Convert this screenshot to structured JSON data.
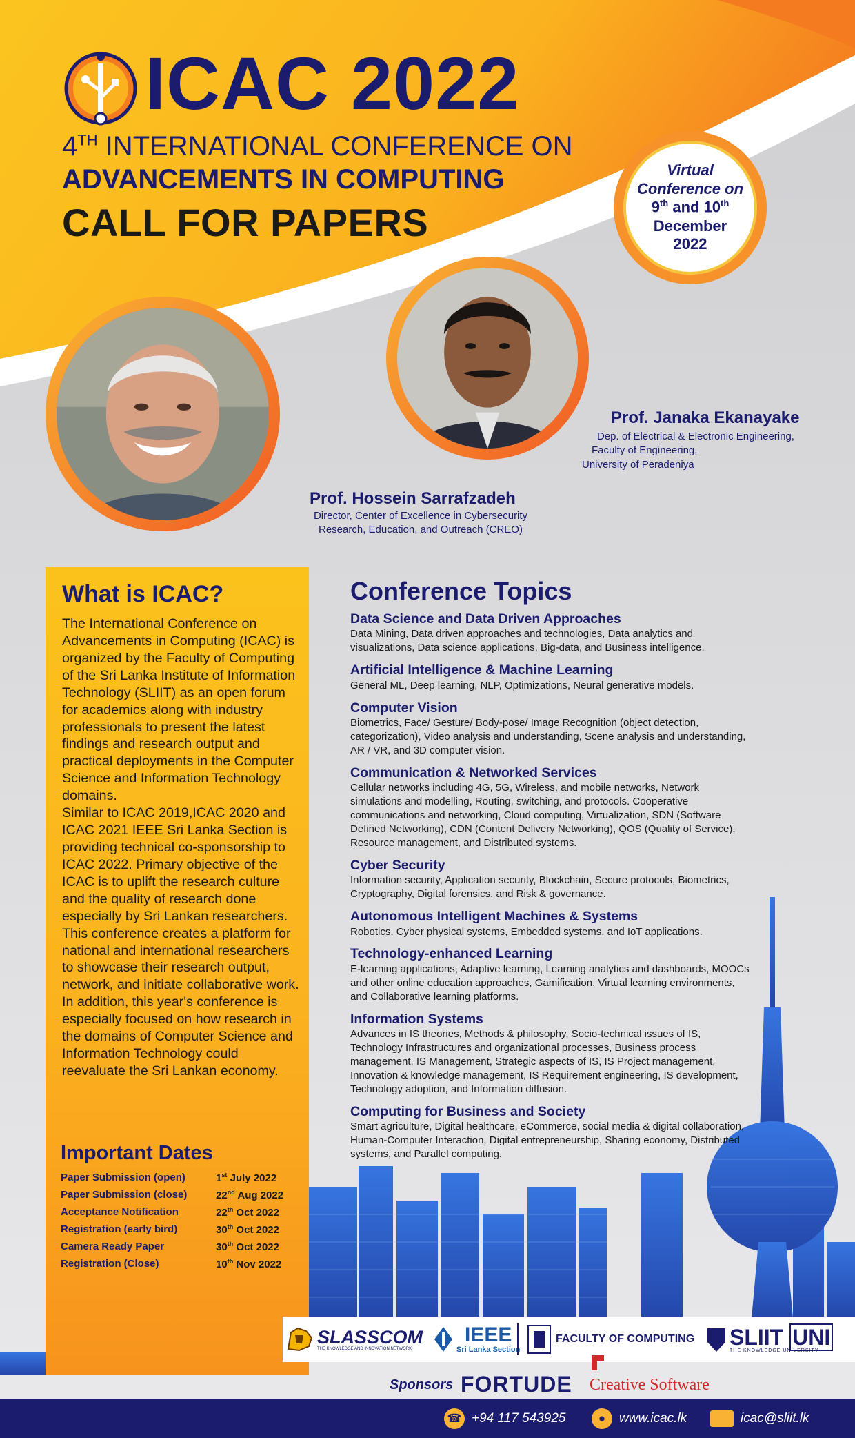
{
  "header": {
    "brand": "ICAC 2022",
    "conference_line1_prefix": "4",
    "conference_line1_sup": "TH",
    "conference_line1_rest": " INTERNATIONAL CONFERENCE ON",
    "conference_line2": "ADVANCEMENTS IN COMPUTING",
    "call_for_papers": "CALL FOR PAPERS"
  },
  "badge": {
    "line1": "Virtual",
    "line2": "Conference on",
    "day1": "9",
    "day1_sup": "th",
    "and": " and 10",
    "day2_sup": "th",
    "month": "December",
    "year": "2022"
  },
  "speakers": [
    {
      "name": "Prof. Hossein Sarrafzadeh",
      "role_line1": "Director, Center of Excellence in Cybersecurity",
      "role_line2": "Research, Education, and Outreach (CREO)"
    },
    {
      "name": "Prof. Janaka Ekanayake",
      "role_line1": "Dep. of Electrical & Electronic Engineering,",
      "role_line2": "Faculty of Engineering,",
      "role_line3": "University of Peradeniya"
    }
  ],
  "what": {
    "title": "What is ICAC?",
    "p1": "The International Conference on Advancements in Computing (ICAC) is organized by the Faculty of Computing of the Sri Lanka Institute of Information Technology (SLIIT) as an open forum for academics along with industry professionals to present the latest findings and research output and practical deployments in the Computer Science and Information Technology domains.",
    "p2": "Similar to ICAC 2019,ICAC 2020 and ICAC 2021 IEEE Sri Lanka Section is providing technical co-sponsorship to ICAC 2022. Primary objective of the ICAC is to uplift the research culture and the quality of research done especially by Sri Lankan researchers.",
    "p3": "This conference creates a platform for national and international researchers to showcase their research output, network, and initiate collaborative work. In addition, this year's conference is especially focused on how research in the domains of Computer Science and Information Technology could reevaluate the Sri Lankan economy."
  },
  "dates": {
    "title": "Important Dates",
    "rows": [
      {
        "label": "Paper Submission (open)",
        "day": "1",
        "sup": "st",
        "rest": " July 2022"
      },
      {
        "label": "Paper Submission (close)",
        "day": "22",
        "sup": "nd",
        "rest": " Aug 2022"
      },
      {
        "label": "Acceptance Notification",
        "day": "22",
        "sup": "th",
        "rest": " Oct 2022"
      },
      {
        "label": "Registration (early bird)",
        "day": "30",
        "sup": "th",
        "rest": " Oct 2022"
      },
      {
        "label": "Camera Ready Paper",
        "day": "30",
        "sup": "th",
        "rest": " Oct 2022"
      },
      {
        "label": "Registration (Close)",
        "day": "10",
        "sup": "th",
        "rest": " Nov 2022"
      }
    ]
  },
  "topics": {
    "title": "Conference Topics",
    "items": [
      {
        "h": "Data Science and Data Driven Approaches",
        "b": "Data Mining, Data driven approaches and technologies, Data analytics and visualizations, Data science applications, Big-data, and Business intelligence."
      },
      {
        "h": "Artificial Intelligence & Machine Learning",
        "b": "General ML, Deep learning, NLP, Optimizations, Neural generative models."
      },
      {
        "h": "Computer Vision",
        "b": "Biometrics, Face/ Gesture/ Body-pose/ Image Recognition (object detection, categorization), Video analysis and understanding, Scene analysis and understanding, AR / VR, and 3D computer vision."
      },
      {
        "h": "Communication & Networked Services",
        "b": "Cellular networks including 4G, 5G, Wireless, and mobile networks, Network simulations and modelling, Routing, switching, and protocols. Cooperative communications and networking, Cloud computing, Virtualization, SDN (Software Defined Networking), CDN (Content Delivery Networking), QOS (Quality of Service), Resource management, and Distributed systems."
      },
      {
        "h": "Cyber Security",
        "b": "Information security, Application security, Blockchain, Secure protocols, Biometrics, Cryptography, Digital forensics, and Risk & governance."
      },
      {
        "h": "Autonomous Intelligent Machines & Systems",
        "b": "Robotics, Cyber physical systems, Embedded systems, and IoT applications."
      },
      {
        "h": "Technology-enhanced Learning",
        "b": "E-learning applications, Adaptive learning, Learning analytics and dashboards, MOOCs and other online education approaches, Gamification, Virtual learning environments, and Collaborative learning platforms."
      },
      {
        "h": "Information Systems",
        "b": "Advances in IS theories, Methods & philosophy, Socio-technical issues of IS, Technology Infrastructures and organizational processes, Business process management, IS Management, Strategic aspects of IS, IS Project management, Innovation & knowledge management, IS Requirement engineering, IS development, Technology adoption, and Information diffusion."
      },
      {
        "h": "Computing for Business and Society",
        "b": "Smart agriculture, Digital healthcare, eCommerce, social media & digital collaboration, Human-Computer Interaction, Digital entrepreneurship, Sharing economy, Distributed systems, and Parallel computing."
      }
    ]
  },
  "sponsors": {
    "slasscom": "SLASSCOM",
    "slasscom_tag": "THE KNOWLEDGE AND INNOVATION NETWORK",
    "ieee": "IEEE",
    "ieee_section": "Sri Lanka Section",
    "faculty": "FACULTY OF COMPUTING",
    "sliit": "SLIIT",
    "uni": "UNI",
    "sliit_tag": "THE KNOWLEDGE UNIVERSITY",
    "label": "Sponsors",
    "fortude": "FORTUDE",
    "creative": "Creative Software"
  },
  "footer": {
    "phone": "+94 117 543925",
    "web": "www.icac.lk",
    "email": "icac@sliit.lk"
  },
  "colors": {
    "navy": "#1b1c6e",
    "orange": "#f7912a",
    "yellow": "#fbc21c"
  }
}
